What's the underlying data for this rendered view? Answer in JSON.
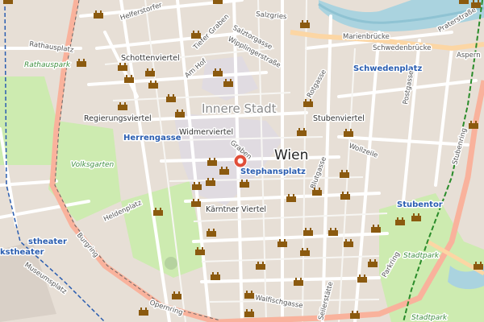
{
  "map": {
    "city_label": "Wien",
    "district_label": "Innere Stadt",
    "districts": [
      "Schottenviertel",
      "Regierungsviertel",
      "Widmerviertel",
      "Stubenviertel",
      "Kärntner Viertel"
    ],
    "stations": [
      "Herrengasse",
      "Stephansplatz",
      "Schwedenplatz",
      "Stubentor",
      "stheater"
    ],
    "parks": [
      "Rathauspark",
      "Volksgarten",
      "Stadtpark",
      "Stadtpark"
    ],
    "streets": {
      "rathausplatz": "Rathausplatz",
      "helferstorfer": "Helferstorfer",
      "tiefer_graben": "Tiefer Graben",
      "am_hof": "Am Hof",
      "salzgries": "Salzgries",
      "salztorgasse": "Salztorgasse",
      "wipplingerstrasse": "Wipplingerstraße",
      "marienbruecke": "Marienbrücke",
      "schwedenbruecke": "Schwedenbrücke",
      "aspern": "Aspern",
      "praterstrasse": "Praterstraße",
      "rotgasse": "Rotgasse",
      "postgasse": "Postgasse",
      "graben": "Graben",
      "wollzeile": "Wollzeile",
      "stubenring": "Stubenring",
      "blutgasse": "Blutgasse",
      "heldenplatz": "Heldenplatz",
      "burgring": "Burgring",
      "museumsplatz": "Museumsplatz",
      "opernring": "Opernring",
      "walfischgasse": "Walfischgasse",
      "seilerstaette": "Seilerstätte",
      "parkring": "Parkring",
      "kstheater": "kstheater"
    },
    "marker_color": "#e04e39",
    "poi_icon": "castle-icon",
    "poi_color": "#8b5a0f",
    "marker_icon": "location-pin-icon"
  }
}
